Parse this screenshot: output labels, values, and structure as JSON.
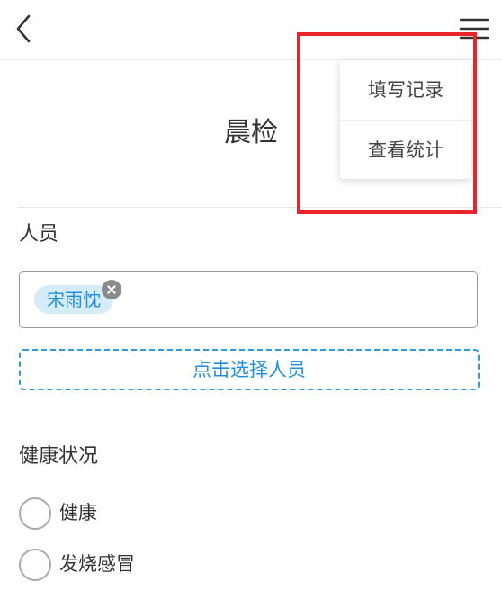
{
  "header": {
    "back_icon": "chevron-left-icon",
    "menu_icon": "hamburger-menu-icon"
  },
  "page": {
    "title": "晨检"
  },
  "personnel": {
    "label": "人员",
    "selected": [
      "宋雨忱"
    ],
    "select_button_label": "点击选择人员"
  },
  "health": {
    "label": "健康状况",
    "options": [
      "健康",
      "发烧感冒"
    ]
  },
  "menu": {
    "items": [
      "填写记录",
      "查看统计"
    ]
  },
  "colors": {
    "accent": "#1e8fe0",
    "tag_bg": "#d6ecfb",
    "highlight": "#e8252a"
  }
}
